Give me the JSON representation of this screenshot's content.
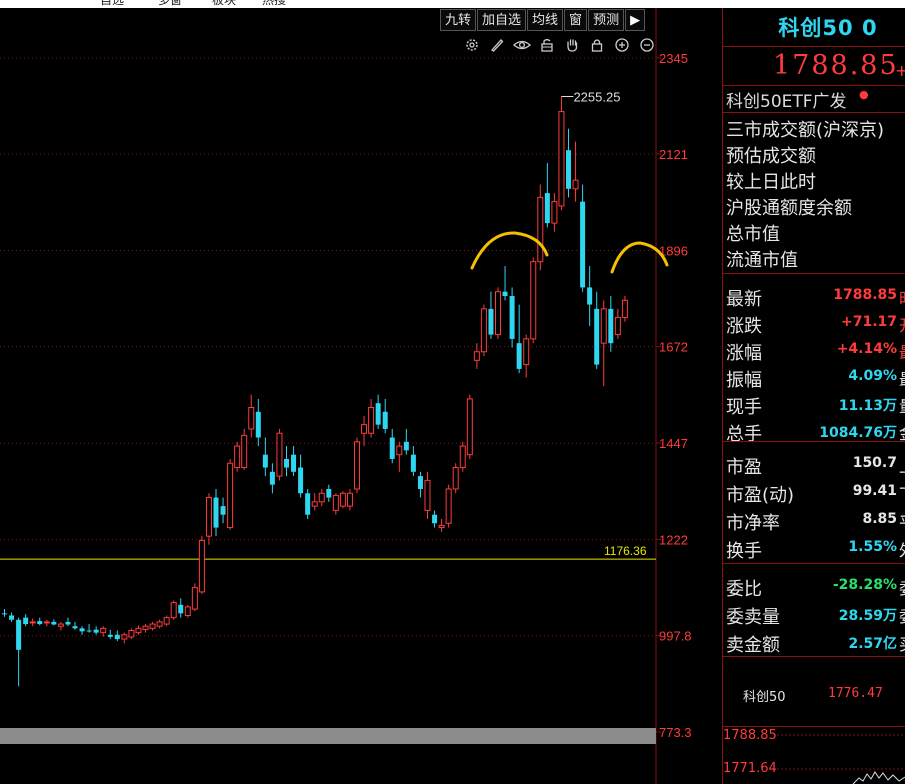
{
  "menu": {
    "items": [
      "自选",
      "多窗",
      "板块",
      "热搜"
    ]
  },
  "toolbar": {
    "buttons": [
      "九转",
      "加自选",
      "均线",
      "窗",
      "预测"
    ],
    "collapse_glyph": "▶"
  },
  "chart_tools": {
    "icons": [
      "gear-icon",
      "pen-icon",
      "eye-icon",
      "lock-open-icon",
      "hand-icon",
      "lock-icon",
      "zoom-in-icon",
      "zoom-out-icon"
    ]
  },
  "chart_data": {
    "type": "candlestick",
    "y_ticks": [
      "2345",
      "2121",
      "1896",
      "1672",
      "1447",
      "1222",
      "997.8",
      "773.3"
    ],
    "y_tick_values": [
      2345,
      2121,
      1896,
      1672,
      1447,
      1222,
      997.8,
      773.3
    ],
    "ylim": [
      773.3,
      2345
    ],
    "grid": "horizontal dotted",
    "annotations": {
      "high_label": "2255.25",
      "high_value": 2255.25,
      "reference_label": "1176.36",
      "reference_value": 1176.36
    },
    "candles": [
      [
        1050,
        1060,
        1042,
        1048
      ],
      [
        1045,
        1052,
        1030,
        1035
      ],
      [
        1035,
        1040,
        880,
        965
      ],
      [
        1040,
        1048,
        1020,
        1025
      ],
      [
        1028,
        1038,
        1020,
        1030
      ],
      [
        1032,
        1040,
        1022,
        1025
      ],
      [
        1028,
        1035,
        1020,
        1030
      ],
      [
        1030,
        1036,
        1022,
        1024
      ],
      [
        1020,
        1030,
        1010,
        1025
      ],
      [
        1030,
        1040,
        1020,
        1024
      ],
      [
        1020,
        1030,
        1012,
        1015
      ],
      [
        1015,
        1020,
        1000,
        1008
      ],
      [
        1010,
        1025,
        1005,
        1008
      ],
      [
        1012,
        1020,
        1000,
        1005
      ],
      [
        1005,
        1020,
        995,
        1015
      ],
      [
        1000,
        1012,
        990,
        995
      ],
      [
        1000,
        1010,
        985,
        990
      ],
      [
        990,
        1005,
        980,
        1000
      ],
      [
        995,
        1015,
        990,
        1010
      ],
      [
        1005,
        1022,
        1000,
        1015
      ],
      [
        1012,
        1025,
        1005,
        1020
      ],
      [
        1015,
        1030,
        1010,
        1025
      ],
      [
        1020,
        1035,
        1015,
        1030
      ],
      [
        1025,
        1045,
        1020,
        1040
      ],
      [
        1040,
        1080,
        1035,
        1075
      ],
      [
        1070,
        1085,
        1040,
        1050
      ],
      [
        1045,
        1070,
        1040,
        1065
      ],
      [
        1060,
        1120,
        1055,
        1110
      ],
      [
        1100,
        1230,
        1095,
        1220
      ],
      [
        1230,
        1330,
        1210,
        1320
      ],
      [
        1320,
        1340,
        1230,
        1250
      ],
      [
        1300,
        1320,
        1260,
        1280
      ],
      [
        1250,
        1410,
        1245,
        1400
      ],
      [
        1390,
        1450,
        1380,
        1440
      ],
      [
        1390,
        1480,
        1385,
        1465
      ],
      [
        1480,
        1560,
        1460,
        1530
      ],
      [
        1520,
        1550,
        1440,
        1460
      ],
      [
        1420,
        1460,
        1370,
        1390
      ],
      [
        1380,
        1400,
        1330,
        1350
      ],
      [
        1370,
        1480,
        1360,
        1470
      ],
      [
        1410,
        1440,
        1370,
        1390
      ],
      [
        1420,
        1440,
        1370,
        1380
      ],
      [
        1390,
        1420,
        1320,
        1330
      ],
      [
        1330,
        1340,
        1270,
        1280
      ],
      [
        1300,
        1330,
        1290,
        1310
      ],
      [
        1310,
        1340,
        1300,
        1330
      ],
      [
        1340,
        1350,
        1310,
        1320
      ],
      [
        1290,
        1330,
        1280,
        1325
      ],
      [
        1300,
        1335,
        1295,
        1330
      ],
      [
        1300,
        1340,
        1290,
        1330
      ],
      [
        1340,
        1460,
        1330,
        1450
      ],
      [
        1470,
        1510,
        1440,
        1490
      ],
      [
        1470,
        1550,
        1460,
        1530
      ],
      [
        1540,
        1560,
        1480,
        1490
      ],
      [
        1520,
        1550,
        1470,
        1480
      ],
      [
        1460,
        1480,
        1400,
        1410
      ],
      [
        1420,
        1450,
        1380,
        1440
      ],
      [
        1450,
        1480,
        1420,
        1430
      ],
      [
        1420,
        1440,
        1370,
        1380
      ],
      [
        1370,
        1380,
        1320,
        1340
      ],
      [
        1290,
        1380,
        1270,
        1360
      ],
      [
        1280,
        1290,
        1250,
        1260
      ],
      [
        1250,
        1270,
        1240,
        1255
      ],
      [
        1260,
        1350,
        1250,
        1340
      ],
      [
        1340,
        1400,
        1330,
        1390
      ],
      [
        1390,
        1450,
        1380,
        1440
      ],
      [
        1420,
        1560,
        1410,
        1550
      ],
      [
        1640,
        1680,
        1620,
        1660
      ],
      [
        1660,
        1770,
        1650,
        1760
      ],
      [
        1760,
        1800,
        1690,
        1700
      ],
      [
        1700,
        1810,
        1690,
        1800
      ],
      [
        1800,
        1860,
        1780,
        1790
      ],
      [
        1790,
        1810,
        1670,
        1690
      ],
      [
        1680,
        1770,
        1610,
        1620
      ],
      [
        1630,
        1700,
        1600,
        1690
      ],
      [
        1690,
        1880,
        1680,
        1870
      ],
      [
        1870,
        2050,
        1850,
        2020
      ],
      [
        2030,
        2100,
        1950,
        1960
      ],
      [
        1960,
        2030,
        1940,
        2010
      ],
      [
        2000,
        2255,
        1990,
        2220
      ],
      [
        2130,
        2180,
        2020,
        2040
      ],
      [
        2040,
        2150,
        2010,
        2060
      ],
      [
        2010,
        2050,
        1800,
        1810
      ],
      [
        1810,
        1860,
        1720,
        1770
      ],
      [
        1760,
        1800,
        1620,
        1630
      ],
      [
        1680,
        1780,
        1580,
        1760
      ],
      [
        1760,
        1790,
        1660,
        1680
      ],
      [
        1700,
        1760,
        1690,
        1740
      ],
      [
        1740,
        1790,
        1730,
        1780
      ]
    ],
    "bullish_color": "#ff3b3b",
    "bearish_color": "#2fd6f0",
    "reference_color": "#e6e600",
    "drawing_color": "#f5c000"
  },
  "quote": {
    "title": "科创50 0",
    "price": "1788.85",
    "price_extra": "+",
    "etf_label": "科创50ETF广发",
    "etf_dot": "●",
    "market_labels": [
      "三市成交额(沪深京)",
      "预估成交额",
      "较上日此时",
      "沪股通额度余额",
      "总市值",
      "流通市值"
    ],
    "rows": [
      {
        "label": "最新",
        "value": "1788.85",
        "suffix": "时",
        "color": "red"
      },
      {
        "label": "涨跌",
        "value": "+71.17",
        "suffix": "开",
        "color": "red"
      },
      {
        "label": "涨幅",
        "value": "+4.14%",
        "suffix": "最",
        "color": "red"
      },
      {
        "label": "振幅",
        "value": "4.09%",
        "suffix": "最",
        "color": "cyan"
      },
      {
        "label": "现手",
        "value": "11.13万",
        "suffix": "量",
        "color": "cyan"
      },
      {
        "label": "总手",
        "value": "1084.76万",
        "suffix": "金",
        "color": "cyan"
      },
      {
        "label": "市盈",
        "value": "150.7",
        "suffix": "上",
        "color": "white"
      },
      {
        "label": "市盈(动)",
        "value": "99.41",
        "suffix": "下",
        "color": "white"
      },
      {
        "label": "市净率",
        "value": "8.85",
        "suffix": "平",
        "color": "white"
      },
      {
        "label": "换手",
        "value": "1.55%",
        "suffix": "外",
        "color": "cyan"
      },
      {
        "label": "委比",
        "value": "-28.28%",
        "suffix": "委",
        "color": "green"
      },
      {
        "label": "委卖量",
        "value": "28.59万",
        "suffix": "委",
        "color": "cyan"
      },
      {
        "label": "卖金额",
        "value": "2.57亿",
        "suffix": "买",
        "color": "cyan"
      }
    ],
    "kc_label": "科创50",
    "kc_value": "1776.47",
    "mini_labels": [
      "1788.85",
      "1771.64"
    ]
  }
}
